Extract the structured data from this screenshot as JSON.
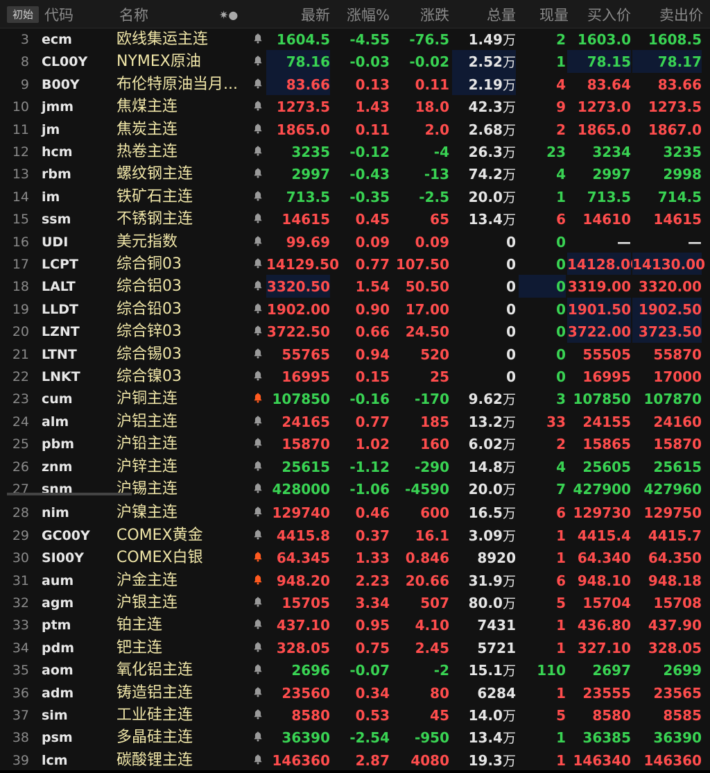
{
  "toolbar": {
    "reset_label": "初始"
  },
  "columns": {
    "code": "代码",
    "name": "名称",
    "settings": "✷●",
    "last": "最新",
    "pct": "涨幅%",
    "chg": "涨跌",
    "vol": "总量",
    "cur": "现量",
    "bid": "买入价",
    "ask": "卖出价"
  },
  "colors": {
    "up": "#ff4d4d",
    "down": "#39d353",
    "name": "#f0e6a8",
    "bell_gray": "#9a9a9a",
    "bell_active": "#ff5a1f"
  },
  "rows": [
    {
      "n": "3",
      "code": "ecm",
      "name": "欧线集运主连",
      "bell": "gray",
      "last": "1604.5",
      "pct": "-4.55",
      "chg": "-76.5",
      "vol": "1.49",
      "volu": "万",
      "cur": "2",
      "bid": "1603.0",
      "ask": "1608.5",
      "dir": "dn"
    },
    {
      "n": "8",
      "code": "CL00Y",
      "name": "NYMEX原油",
      "bell": "gray",
      "last": "78.16",
      "pct": "-0.03",
      "chg": "-0.02",
      "vol": "2.52",
      "volu": "万",
      "cur": "1",
      "bid": "78.15",
      "ask": "78.17",
      "dir": "dn"
    },
    {
      "n": "9",
      "code": "B00Y",
      "name": "布伦特原油当月...",
      "bell": "gray",
      "last": "83.66",
      "pct": "0.13",
      "chg": "0.11",
      "vol": "2.19",
      "volu": "万",
      "cur": "4",
      "bid": "83.64",
      "ask": "83.66",
      "dir": "up"
    },
    {
      "n": "10",
      "code": "jmm",
      "name": "焦煤主连",
      "bell": "gray",
      "last": "1273.5",
      "pct": "1.43",
      "chg": "18.0",
      "vol": "42.3",
      "volu": "万",
      "cur": "9",
      "bid": "1273.0",
      "ask": "1273.5",
      "dir": "up"
    },
    {
      "n": "11",
      "code": "jm",
      "name": "焦炭主连",
      "bell": "gray",
      "last": "1865.0",
      "pct": "0.11",
      "chg": "2.0",
      "vol": "2.68",
      "volu": "万",
      "cur": "2",
      "bid": "1865.0",
      "ask": "1867.0",
      "dir": "up"
    },
    {
      "n": "12",
      "code": "hcm",
      "name": "热卷主连",
      "bell": "gray",
      "last": "3235",
      "pct": "-0.12",
      "chg": "-4",
      "vol": "26.3",
      "volu": "万",
      "cur": "23",
      "bid": "3234",
      "ask": "3235",
      "dir": "dn"
    },
    {
      "n": "13",
      "code": "rbm",
      "name": "螺纹钢主连",
      "bell": "gray",
      "last": "2997",
      "pct": "-0.43",
      "chg": "-13",
      "vol": "74.2",
      "volu": "万",
      "cur": "4",
      "bid": "2997",
      "ask": "2998",
      "dir": "dn"
    },
    {
      "n": "14",
      "code": "im",
      "name": "铁矿石主连",
      "bell": "gray",
      "last": "713.5",
      "pct": "-0.35",
      "chg": "-2.5",
      "vol": "20.0",
      "volu": "万",
      "cur": "1",
      "bid": "713.5",
      "ask": "714.5",
      "dir": "dn"
    },
    {
      "n": "15",
      "code": "ssm",
      "name": "不锈钢主连",
      "bell": "gray",
      "last": "14615",
      "pct": "0.45",
      "chg": "65",
      "vol": "13.4",
      "volu": "万",
      "cur": "6",
      "bid": "14610",
      "ask": "14615",
      "dir": "up"
    },
    {
      "n": "16",
      "code": "UDI",
      "name": "美元指数",
      "bell": "gray",
      "last": "99.69",
      "pct": "0.09",
      "chg": "0.09",
      "vol": "0",
      "volu": "",
      "cur": "0",
      "bid": "—",
      "ask": "—",
      "dir": "up"
    },
    {
      "n": "17",
      "code": "LCPT",
      "name": "综合铜03",
      "bell": "gray",
      "last": "14129.50",
      "pct": "0.77",
      "chg": "107.50",
      "vol": "0",
      "volu": "",
      "cur": "0",
      "bid": "14128.00",
      "ask": "14130.00",
      "dir": "up"
    },
    {
      "n": "18",
      "code": "LALT",
      "name": "综合铝03",
      "bell": "gray",
      "last": "3320.50",
      "pct": "1.54",
      "chg": "50.50",
      "vol": "0",
      "volu": "",
      "cur": "0",
      "bid": "3319.00",
      "ask": "3320.00",
      "dir": "up"
    },
    {
      "n": "19",
      "code": "LLDT",
      "name": "综合铅03",
      "bell": "gray",
      "last": "1902.00",
      "pct": "0.90",
      "chg": "17.00",
      "vol": "0",
      "volu": "",
      "cur": "0",
      "bid": "1901.50",
      "ask": "1902.50",
      "dir": "up"
    },
    {
      "n": "20",
      "code": "LZNT",
      "name": "综合锌03",
      "bell": "gray",
      "last": "3722.50",
      "pct": "0.66",
      "chg": "24.50",
      "vol": "0",
      "volu": "",
      "cur": "0",
      "bid": "3722.00",
      "ask": "3723.50",
      "dir": "up"
    },
    {
      "n": "21",
      "code": "LTNT",
      "name": "综合锡03",
      "bell": "gray",
      "last": "55765",
      "pct": "0.94",
      "chg": "520",
      "vol": "0",
      "volu": "",
      "cur": "0",
      "bid": "55505",
      "ask": "55870",
      "dir": "up"
    },
    {
      "n": "22",
      "code": "LNKT",
      "name": "综合镍03",
      "bell": "gray",
      "last": "16995",
      "pct": "0.15",
      "chg": "25",
      "vol": "0",
      "volu": "",
      "cur": "0",
      "bid": "16995",
      "ask": "17000",
      "dir": "up"
    },
    {
      "n": "23",
      "code": "cum",
      "name": "沪铜主连",
      "bell": "active",
      "last": "107850",
      "pct": "-0.16",
      "chg": "-170",
      "vol": "9.62",
      "volu": "万",
      "cur": "3",
      "bid": "107850",
      "ask": "107870",
      "dir": "dn"
    },
    {
      "n": "24",
      "code": "alm",
      "name": "沪铝主连",
      "bell": "gray",
      "last": "24165",
      "pct": "0.77",
      "chg": "185",
      "vol": "13.2",
      "volu": "万",
      "cur": "33",
      "bid": "24155",
      "ask": "24160",
      "dir": "up"
    },
    {
      "n": "25",
      "code": "pbm",
      "name": "沪铅主连",
      "bell": "gray",
      "last": "15870",
      "pct": "1.02",
      "chg": "160",
      "vol": "6.02",
      "volu": "万",
      "cur": "2",
      "bid": "15865",
      "ask": "15870",
      "dir": "up"
    },
    {
      "n": "26",
      "code": "znm",
      "name": "沪锌主连",
      "bell": "gray",
      "last": "25615",
      "pct": "-1.12",
      "chg": "-290",
      "vol": "14.8",
      "volu": "万",
      "cur": "4",
      "bid": "25605",
      "ask": "25615",
      "dir": "dn"
    },
    {
      "n": "27",
      "code": "snm",
      "name": "沪锡主连",
      "bell": "gray",
      "last": "428000",
      "pct": "-1.06",
      "chg": "-4590",
      "vol": "20.0",
      "volu": "万",
      "cur": "7",
      "bid": "427900",
      "ask": "427960",
      "dir": "dn"
    },
    {
      "n": "28",
      "code": "nim",
      "name": "沪镍主连",
      "bell": "gray",
      "last": "129740",
      "pct": "0.46",
      "chg": "600",
      "vol": "16.5",
      "volu": "万",
      "cur": "6",
      "bid": "129730",
      "ask": "129750",
      "dir": "up"
    },
    {
      "n": "29",
      "code": "GC00Y",
      "name": "COMEX黄金",
      "bell": "gray",
      "last": "4415.8",
      "pct": "0.37",
      "chg": "16.1",
      "vol": "3.09",
      "volu": "万",
      "cur": "1",
      "bid": "4415.4",
      "ask": "4415.7",
      "dir": "up"
    },
    {
      "n": "30",
      "code": "SI00Y",
      "name": "COMEX白银",
      "bell": "active",
      "last": "64.345",
      "pct": "1.33",
      "chg": "0.846",
      "vol": "8920",
      "volu": "",
      "cur": "1",
      "bid": "64.340",
      "ask": "64.350",
      "dir": "up"
    },
    {
      "n": "31",
      "code": "aum",
      "name": "沪金主连",
      "bell": "active",
      "last": "948.20",
      "pct": "2.23",
      "chg": "20.66",
      "vol": "31.9",
      "volu": "万",
      "cur": "6",
      "bid": "948.10",
      "ask": "948.18",
      "dir": "up"
    },
    {
      "n": "32",
      "code": "agm",
      "name": "沪银主连",
      "bell": "gray",
      "last": "15705",
      "pct": "3.34",
      "chg": "507",
      "vol": "80.0",
      "volu": "万",
      "cur": "5",
      "bid": "15704",
      "ask": "15708",
      "dir": "up"
    },
    {
      "n": "33",
      "code": "ptm",
      "name": "铂主连",
      "bell": "gray",
      "last": "437.10",
      "pct": "0.95",
      "chg": "4.10",
      "vol": "7431",
      "volu": "",
      "cur": "1",
      "bid": "436.80",
      "ask": "437.90",
      "dir": "up"
    },
    {
      "n": "34",
      "code": "pdm",
      "name": "钯主连",
      "bell": "gray",
      "last": "328.05",
      "pct": "0.75",
      "chg": "2.45",
      "vol": "5721",
      "volu": "",
      "cur": "1",
      "bid": "327.10",
      "ask": "328.05",
      "dir": "up"
    },
    {
      "n": "35",
      "code": "aom",
      "name": "氧化铝主连",
      "bell": "gray",
      "last": "2696",
      "pct": "-0.07",
      "chg": "-2",
      "vol": "15.1",
      "volu": "万",
      "cur": "110",
      "bid": "2697",
      "ask": "2699",
      "dir": "dn"
    },
    {
      "n": "36",
      "code": "adm",
      "name": "铸造铝主连",
      "bell": "gray",
      "last": "23560",
      "pct": "0.34",
      "chg": "80",
      "vol": "6284",
      "volu": "",
      "cur": "1",
      "bid": "23555",
      "ask": "23565",
      "dir": "up"
    },
    {
      "n": "37",
      "code": "sim",
      "name": "工业硅主连",
      "bell": "gray",
      "last": "8580",
      "pct": "0.53",
      "chg": "45",
      "vol": "14.0",
      "volu": "万",
      "cur": "5",
      "bid": "8580",
      "ask": "8585",
      "dir": "up"
    },
    {
      "n": "38",
      "code": "psm",
      "name": "多晶硅主连",
      "bell": "gray",
      "last": "36390",
      "pct": "-2.54",
      "chg": "-950",
      "vol": "13.4",
      "volu": "万",
      "cur": "1",
      "bid": "36385",
      "ask": "36390",
      "dir": "dn"
    },
    {
      "n": "39",
      "code": "lcm",
      "name": "碳酸锂主连",
      "bell": "gray",
      "last": "146360",
      "pct": "2.87",
      "chg": "4080",
      "vol": "19.3",
      "volu": "万",
      "cur": "1",
      "bid": "146340",
      "ask": "146360",
      "dir": "up"
    }
  ]
}
